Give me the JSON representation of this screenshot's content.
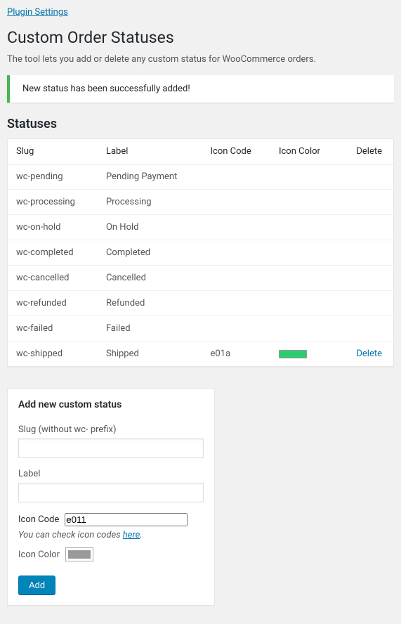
{
  "links": {
    "plugin_settings": "Plugin Settings"
  },
  "page_title": "Custom Order Statuses",
  "description": "The tool lets you add or delete any custom status for WooCommerce orders.",
  "notice": "New status has been successfully added!",
  "section_title": "Statuses",
  "table": {
    "headers": {
      "slug": "Slug",
      "label": "Label",
      "icon_code": "Icon Code",
      "icon_color": "Icon Color",
      "delete": "Delete"
    },
    "rows": [
      {
        "slug": "wc-pending",
        "label": "Pending Payment",
        "icon_code": "",
        "icon_color": "",
        "delete": ""
      },
      {
        "slug": "wc-processing",
        "label": "Processing",
        "icon_code": "",
        "icon_color": "",
        "delete": ""
      },
      {
        "slug": "wc-on-hold",
        "label": "On Hold",
        "icon_code": "",
        "icon_color": "",
        "delete": ""
      },
      {
        "slug": "wc-completed",
        "label": "Completed",
        "icon_code": "",
        "icon_color": "",
        "delete": ""
      },
      {
        "slug": "wc-cancelled",
        "label": "Cancelled",
        "icon_code": "",
        "icon_color": "",
        "delete": ""
      },
      {
        "slug": "wc-refunded",
        "label": "Refunded",
        "icon_code": "",
        "icon_color": "",
        "delete": ""
      },
      {
        "slug": "wc-failed",
        "label": "Failed",
        "icon_code": "",
        "icon_color": "",
        "delete": ""
      },
      {
        "slug": "wc-shipped",
        "label": "Shipped",
        "icon_code": "e01a",
        "icon_color": "#2ecc71",
        "delete": "Delete"
      }
    ]
  },
  "form": {
    "title": "Add new custom status",
    "slug_label": "Slug (without wc- prefix)",
    "label_label": "Label",
    "icon_code_label": "Icon Code",
    "icon_code_value": "e011",
    "help_text_prefix": "You can check icon codes ",
    "help_link": "here",
    "help_text_suffix": ".",
    "icon_color_label": "Icon Color",
    "icon_color_value": "#999999",
    "submit_label": "Add"
  }
}
